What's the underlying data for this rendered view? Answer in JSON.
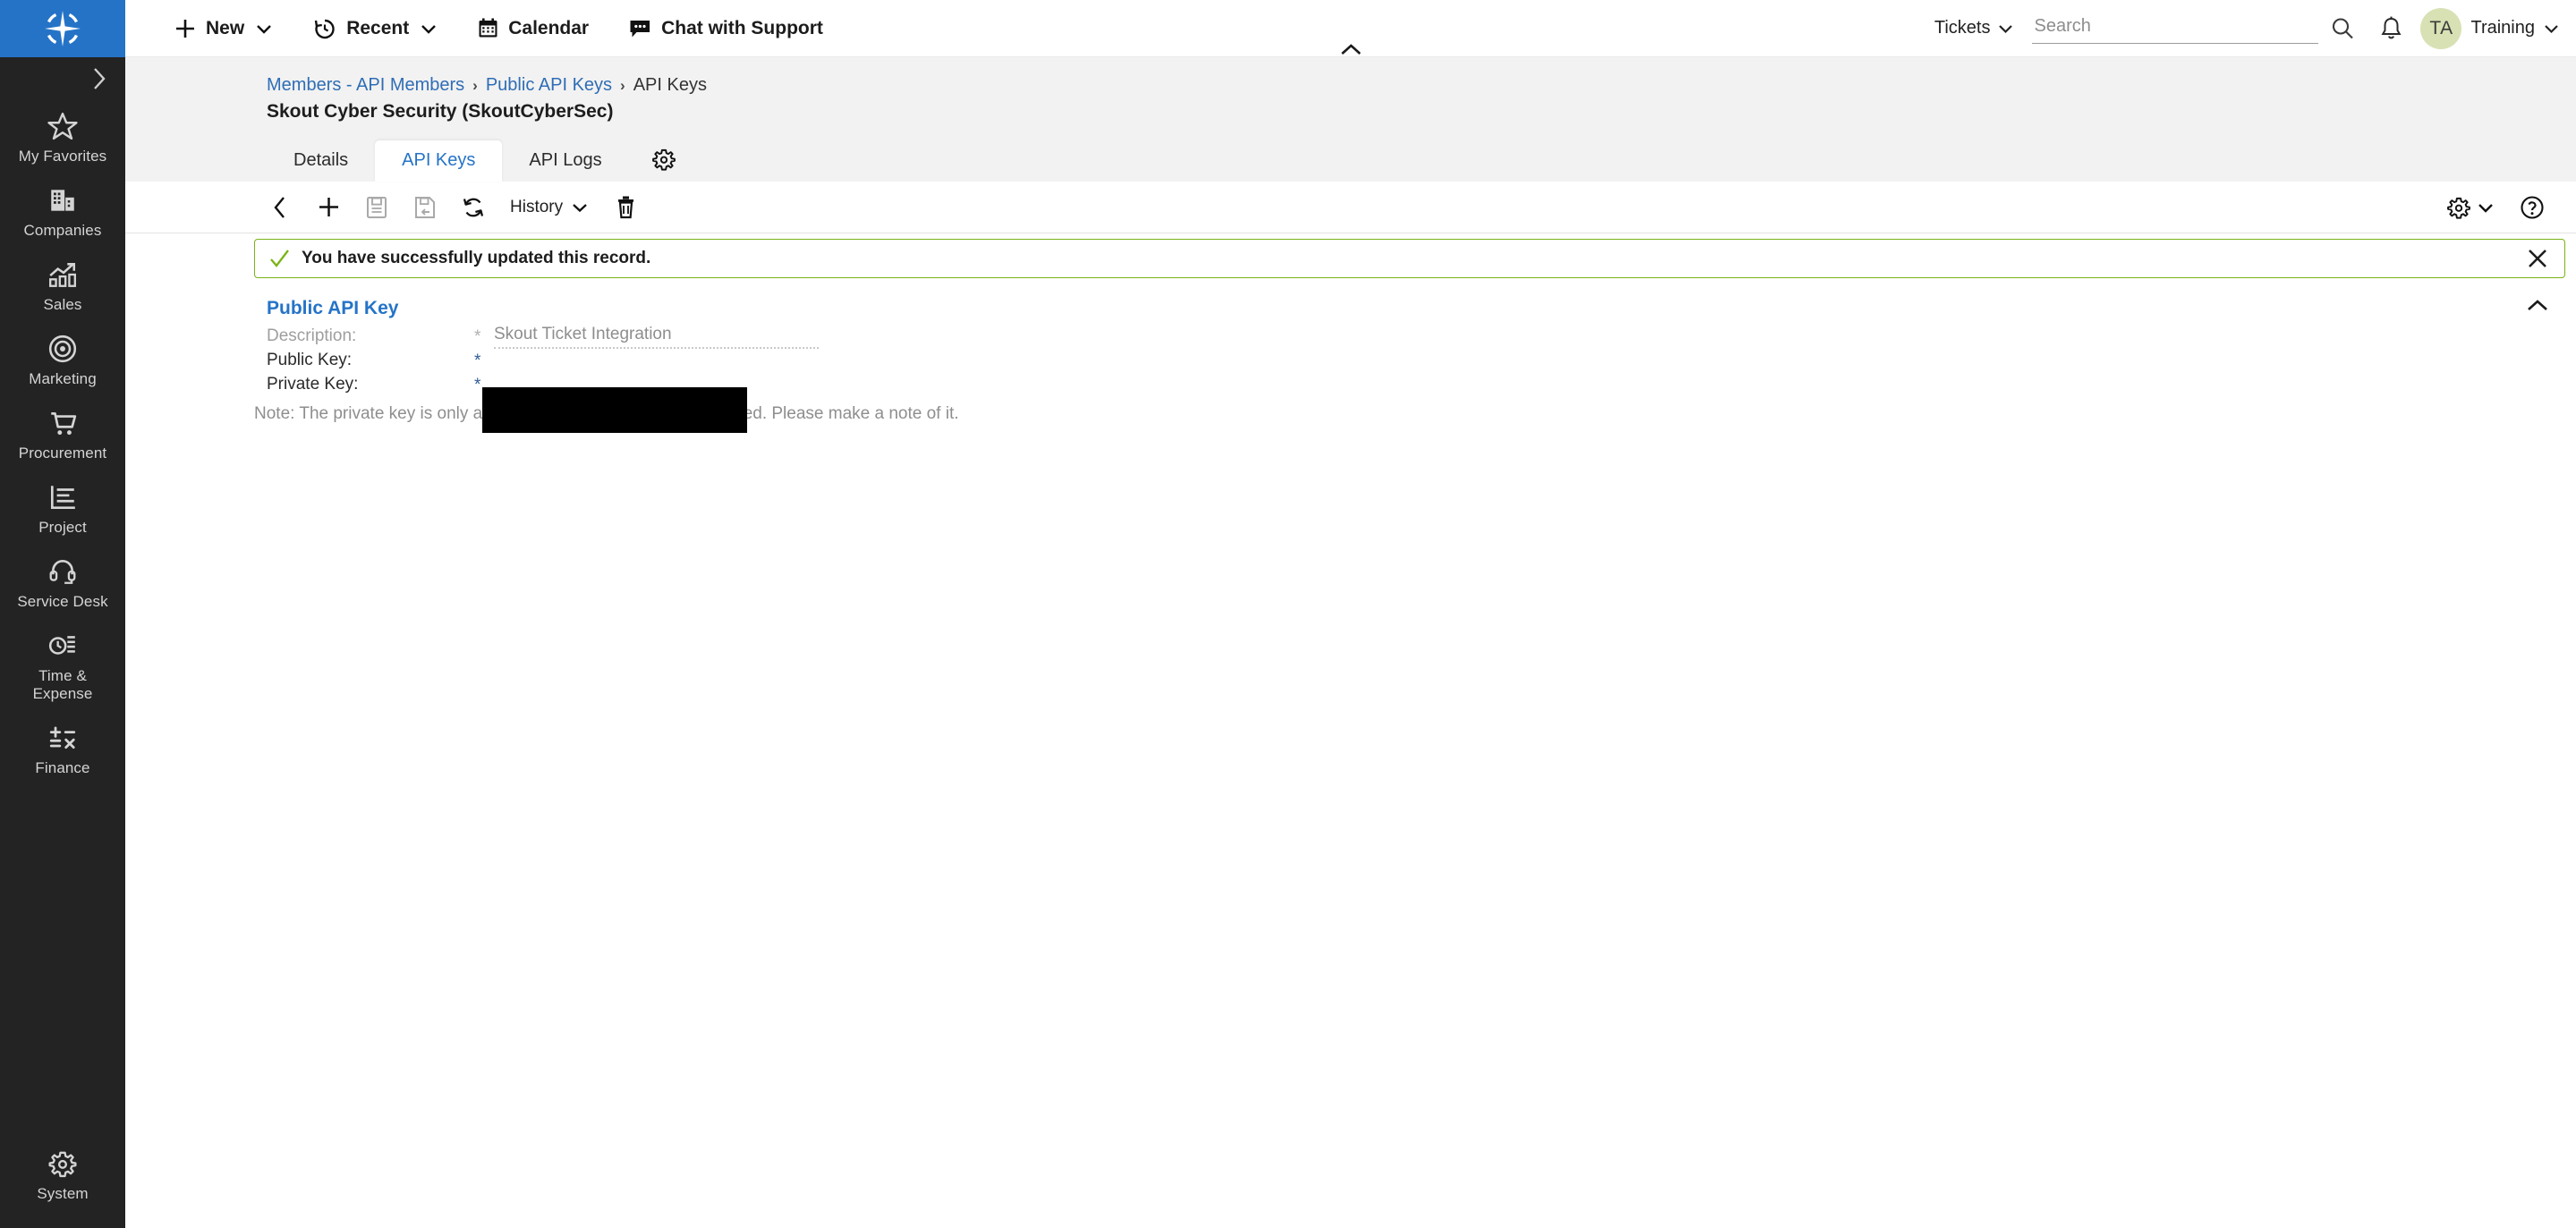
{
  "brand": {
    "logo_icon": "compass-star-logo",
    "logo_color": "#2573c7"
  },
  "topbar": {
    "items": [
      {
        "label": "New",
        "icon": "plus-icon",
        "has_chevron": true
      },
      {
        "label": "Recent",
        "icon": "history-clock-icon",
        "has_chevron": true
      },
      {
        "label": "Calendar",
        "icon": "calendar-icon",
        "has_chevron": false
      },
      {
        "label": "Chat with Support",
        "icon": "chat-bubble-icon",
        "has_chevron": false
      }
    ],
    "tickets_label": "Tickets",
    "search_placeholder": "Search",
    "search_value": "",
    "search_icon": "search-icon",
    "notification_icon": "bell-icon",
    "avatar_initials": "TA",
    "avatar_color": "#d7e1b4",
    "user_name": "Training",
    "collapse_icon": "chevron-up-icon"
  },
  "sidebar": {
    "expand_icon": "chevron-right-icon",
    "items": [
      {
        "label": "My Favorites",
        "icon": "star-icon"
      },
      {
        "label": "Companies",
        "icon": "building-icon"
      },
      {
        "label": "Sales",
        "icon": "bar-chart-trend-icon"
      },
      {
        "label": "Marketing",
        "icon": "target-icon"
      },
      {
        "label": "Procurement",
        "icon": "shopping-cart-icon"
      },
      {
        "label": "Project",
        "icon": "project-chart-icon"
      },
      {
        "label": "Service Desk",
        "icon": "headset-icon"
      },
      {
        "label": "Time &\nExpense",
        "icon": "clock-list-icon"
      },
      {
        "label": "Finance",
        "icon": "calculator-math-icon"
      }
    ],
    "bottom_item": {
      "label": "System",
      "icon": "gear-icon"
    }
  },
  "breadcrumb": {
    "items": [
      {
        "label": "Members - API Members",
        "is_link": true
      },
      {
        "label": "Public API Keys",
        "is_link": true
      },
      {
        "label": "API Keys",
        "is_link": false
      }
    ],
    "separator": "›"
  },
  "record": {
    "title": "Skout Cyber Security (SkoutCyberSec)"
  },
  "tabs": {
    "items": [
      {
        "label": "Details",
        "active": false
      },
      {
        "label": "API Keys",
        "active": true
      },
      {
        "label": "API Logs",
        "active": false
      }
    ],
    "settings_icon": "gear-icon"
  },
  "toolbar": {
    "buttons": [
      {
        "name": "back-button",
        "icon": "chevron-left-icon",
        "disabled": false
      },
      {
        "name": "new-button",
        "icon": "plus-icon",
        "disabled": false
      },
      {
        "name": "save-button",
        "icon": "save-icon",
        "disabled": true
      },
      {
        "name": "save-and-close-button",
        "icon": "save-and-close-icon",
        "disabled": true
      },
      {
        "name": "refresh-button",
        "icon": "refresh-icon",
        "disabled": false
      }
    ],
    "history_label": "History",
    "history_icon": "chevron-down-icon",
    "delete_icon": "trash-icon",
    "settings_icon": "gear-icon",
    "settings_chevron": "chevron-down-icon",
    "help_icon": "question-circle-icon"
  },
  "banner": {
    "icon": "check-icon",
    "message": "You have successfully updated this record.",
    "close_icon": "close-icon",
    "border_color": "#7ab317"
  },
  "panel": {
    "title": "Public API Key",
    "collapse_icon": "chevron-up-icon",
    "fields": [
      {
        "label": "Description:",
        "required_marker": "*",
        "value": "Skout Ticket Integration",
        "disabled": true
      },
      {
        "label": "Public Key:",
        "required_marker": "*",
        "value": "",
        "disabled": false,
        "redacted": true
      },
      {
        "label": "Private Key:",
        "required_marker": "*",
        "value": "",
        "disabled": false,
        "redacted": true
      }
    ],
    "note": "Note: The private key is only available at the time the key is created. Please make a note of it."
  }
}
